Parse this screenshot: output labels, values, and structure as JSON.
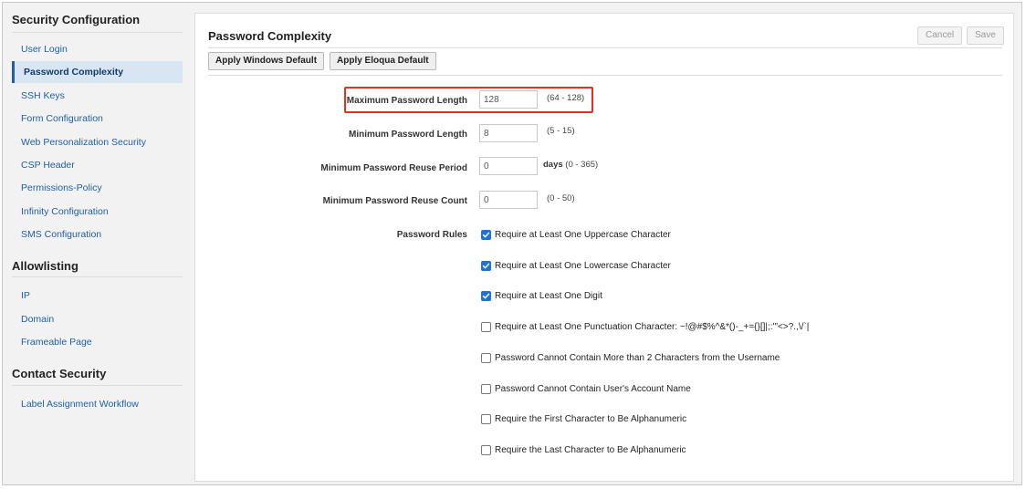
{
  "sidebar": {
    "sections": [
      {
        "title": "Security Configuration",
        "items": [
          {
            "label": "User Login",
            "active": false
          },
          {
            "label": "Password Complexity",
            "active": true
          },
          {
            "label": "SSH Keys",
            "active": false
          },
          {
            "label": "Form Configuration",
            "active": false
          },
          {
            "label": "Web Personalization Security",
            "active": false
          },
          {
            "label": "CSP Header",
            "active": false
          },
          {
            "label": "Permissions-Policy",
            "active": false
          },
          {
            "label": "Infinity Configuration",
            "active": false
          },
          {
            "label": "SMS Configuration",
            "active": false
          }
        ]
      },
      {
        "title": "Allowlisting",
        "items": [
          {
            "label": "IP",
            "active": false
          },
          {
            "label": "Domain",
            "active": false
          },
          {
            "label": "Frameable Page",
            "active": false
          }
        ]
      },
      {
        "title": "Contact Security",
        "items": [
          {
            "label": "Label Assignment Workflow",
            "active": false
          }
        ]
      }
    ]
  },
  "main": {
    "title": "Password Complexity",
    "cancel_label": "Cancel",
    "save_label": "Save",
    "apply_windows_label": "Apply Windows Default",
    "apply_eloqua_label": "Apply Eloqua Default",
    "fields": {
      "max_length": {
        "label": "Maximum Password Length",
        "value": "128",
        "hint": "(64 - 128)"
      },
      "min_length": {
        "label": "Minimum Password Length",
        "value": "8",
        "hint": "(5 - 15)"
      },
      "reuse_period": {
        "label": "Minimum Password Reuse Period",
        "value": "0",
        "unit": "days",
        "hint": "(0 - 365)"
      },
      "reuse_count": {
        "label": "Minimum Password Reuse Count",
        "value": "0",
        "hint": "(0 - 50)"
      }
    },
    "password_rules_label": "Password Rules",
    "rules": [
      {
        "label": "Require at Least One Uppercase Character",
        "checked": true
      },
      {
        "label": "Require at Least One Lowercase Character",
        "checked": true
      },
      {
        "label": "Require at Least One Digit",
        "checked": true
      },
      {
        "label": "Require at Least One Punctuation Character: ~!@#$%^&*()-_+={}[]|;:'\"<>?.,\\/`|",
        "checked": false
      },
      {
        "label": "Password Cannot Contain More than 2 Characters from the Username",
        "checked": false
      },
      {
        "label": "Password Cannot Contain User's Account Name",
        "checked": false
      },
      {
        "label": "Require the First Character to Be Alphanumeric",
        "checked": false
      },
      {
        "label": "Require the Last Character to Be Alphanumeric",
        "checked": false
      }
    ]
  },
  "colors": {
    "link": "#1f5fa8",
    "active_bg": "#d8e6f4",
    "highlight": "#e0321f",
    "checkbox": "#1e73d8"
  }
}
